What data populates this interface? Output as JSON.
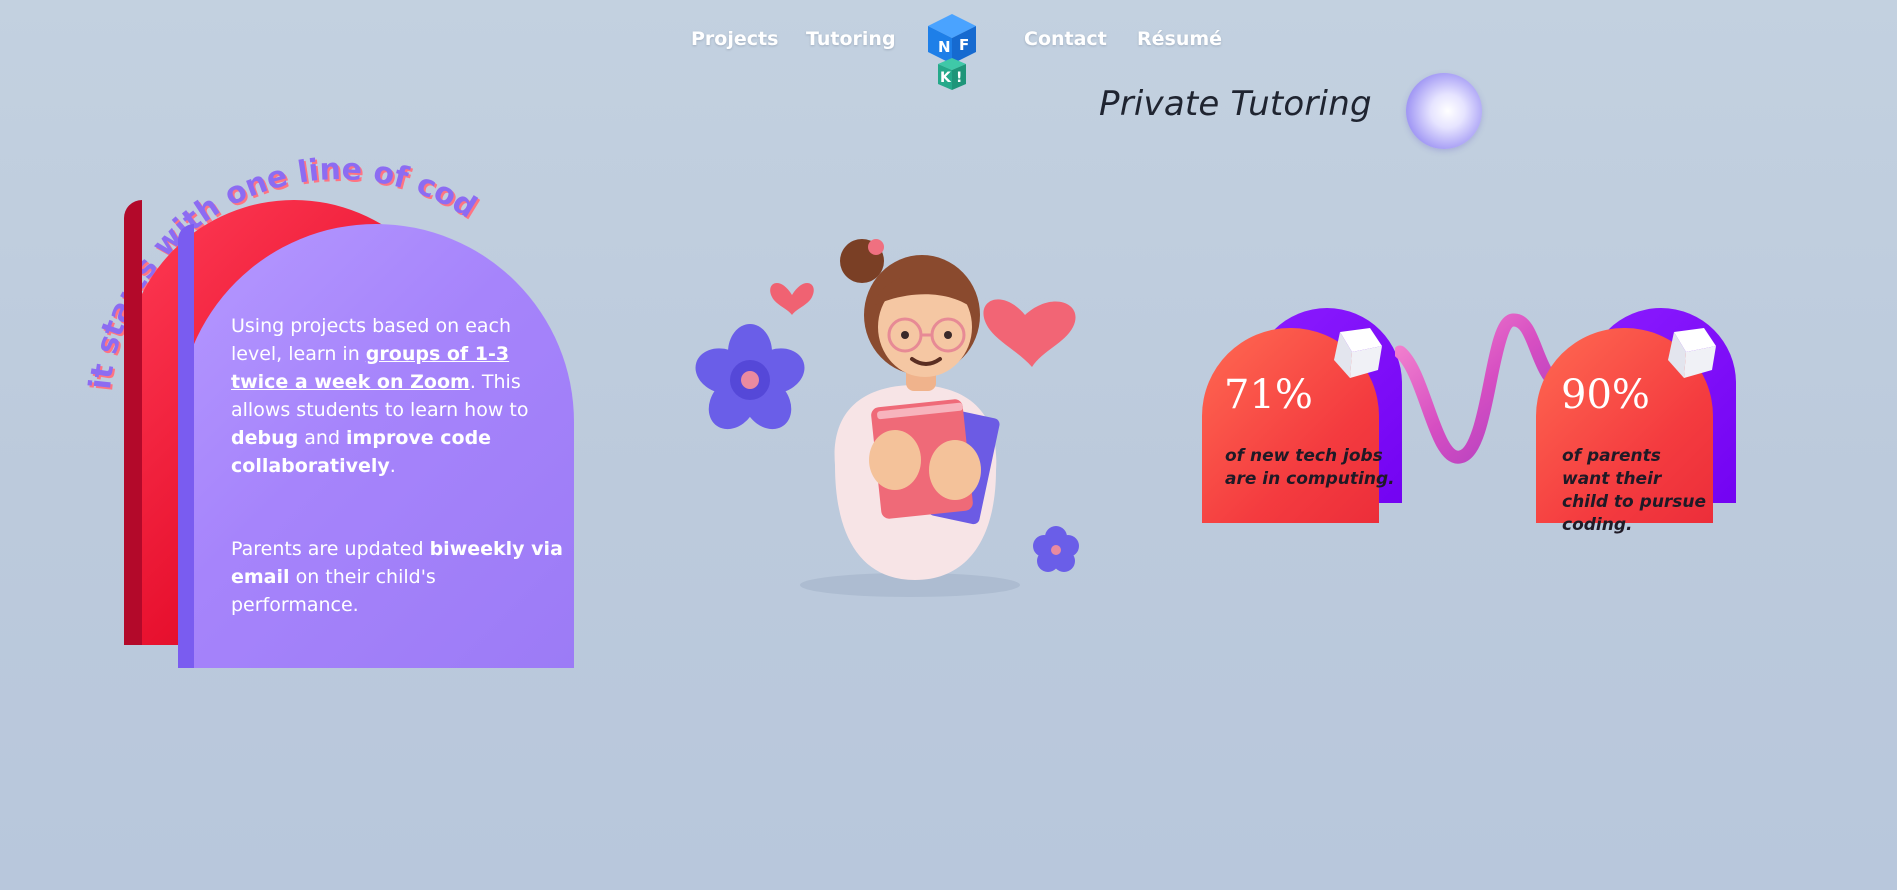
{
  "nav": {
    "projects": "Projects",
    "tutoring": "Tutoring",
    "contact": "Contact",
    "resume": "Résumé",
    "logo_letters": [
      "N",
      "F",
      "K",
      "!"
    ]
  },
  "header": {
    "title": "Private Tutoring"
  },
  "hero": {
    "curved_tagline": "it starts with one line of code.",
    "para1": {
      "t1": "Using projects based on each level, learn in ",
      "t2": "groups of 1-3 twice a week on Zoom",
      "t3": ". This allows students to learn how to ",
      "t4": "debug",
      "t5": " and ",
      "t6": "improve code collaboratively",
      "t7": "."
    },
    "para2": {
      "t1": "Parents are updated ",
      "t2": "biweekly via email",
      "t3": " on their child's performance."
    }
  },
  "stats": [
    {
      "value": "71%",
      "caption": "of new tech jobs are in computing."
    },
    {
      "value": "90%",
      "caption": "of parents want their child to pursue coding."
    }
  ],
  "colors": {
    "accent_purple": "#a684fb",
    "accent_red": "#f43b3f",
    "deep_purple": "#7303f2"
  }
}
